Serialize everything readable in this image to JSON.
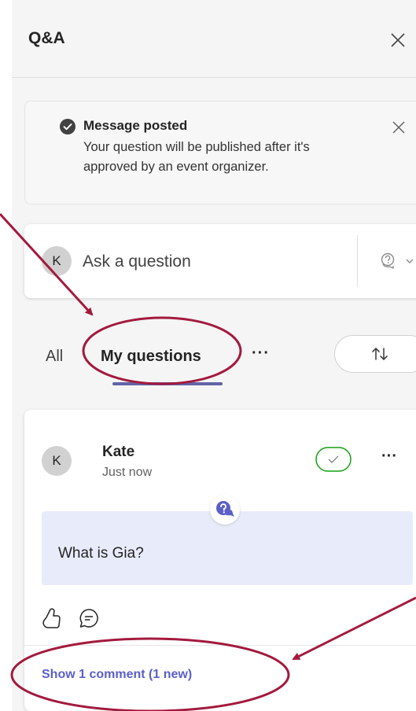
{
  "header": {
    "title": "Q&A",
    "close_icon": "close-icon"
  },
  "toast": {
    "title": "Message posted",
    "body": "Your question will be published after it's approved by an event organizer.",
    "icon": "checkmark-circle-icon"
  },
  "ask": {
    "avatar_initial": "K",
    "placeholder": "Ask a question",
    "type_icon": "question-chat-icon"
  },
  "tabs": {
    "all_label": "All",
    "mine_label": "My questions",
    "more_label": "···",
    "sort_icon": "sort-icon"
  },
  "question": {
    "avatar_initial": "K",
    "author": "Kate",
    "time": "Just now",
    "text": "What is Gia?",
    "more_label": "···",
    "show_comments": "Show 1 comment (1 new)"
  },
  "colors": {
    "accent": "#6264a7",
    "link": "#5b5fc7",
    "approved": "#13a10e",
    "annotation": "#a31a3e",
    "question_bg": "#e8ebfa"
  }
}
